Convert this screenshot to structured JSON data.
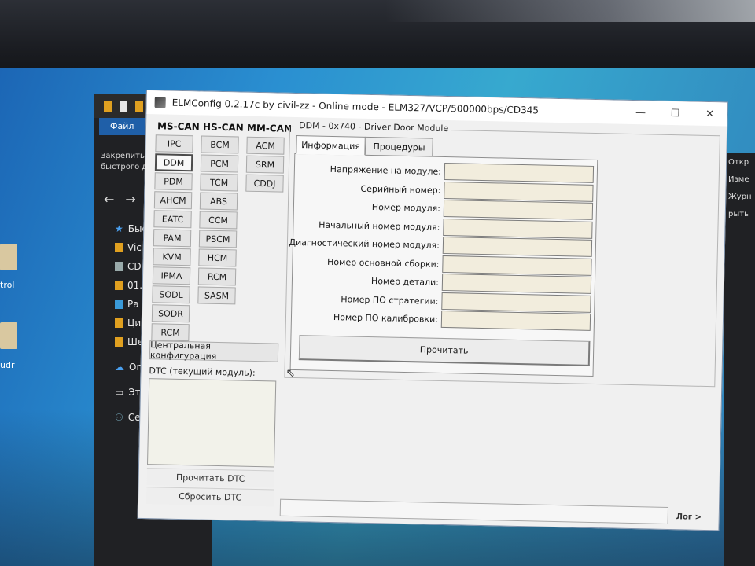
{
  "window": {
    "title": "ELMConfig 0.2.17c by civil-zz - Online mode - ELM327/VCP/500000bps/CD345",
    "minimize": "—",
    "maximize": "☐",
    "close": "✕"
  },
  "explorer": {
    "menu": "Файл",
    "pin_text_1": "Закрепить на",
    "pin_text_2": "быстрого д",
    "nav": [
      "Быс",
      "Vic",
      "CD",
      "01.",
      "Ра",
      "Ци",
      "Ше",
      "One",
      "Этот",
      "Сеть"
    ],
    "right": [
      "Откр",
      "Изме",
      "Журн",
      "рыть"
    ]
  },
  "desktop": {
    "labels": [
      "trol",
      "udr"
    ]
  },
  "modules": {
    "ms_can_header": "MS-CAN",
    "hs_can_header": "HS-CAN",
    "mm_can_header": "MM-CAN",
    "ms_can": [
      "IPC",
      "DDM",
      "PDM",
      "AHCM",
      "EATC",
      "PAM",
      "KVM",
      "IPMA",
      "SODL",
      "SODR",
      "RCM"
    ],
    "hs_can": [
      "BCM",
      "PCM",
      "TCM",
      "ABS",
      "CCM",
      "PSCM",
      "HCM",
      "RCM",
      "SASM"
    ],
    "mm_can": [
      "ACM",
      "SRM",
      "CDDJ"
    ],
    "selected": "DDM"
  },
  "left": {
    "central_config": "Центральная конфигурация",
    "dtc_label": "DTC (текущий модуль):",
    "read_dtc": "Прочитать DTC",
    "clear_dtc": "Сбросить DTC"
  },
  "module_panel": {
    "group_title": "DDM - 0x740 - Driver Door Module",
    "tabs": [
      "Информация",
      "Процедуры"
    ],
    "active_tab": "Информация",
    "fields": [
      "Напряжение на модуле:",
      "Серийный номер:",
      "Номер модуля:",
      "Начальный номер модуля:",
      "Диагностический номер модуля:",
      "Номер основной сборки:",
      "Номер детали:",
      "Номер ПО стратегии:",
      "Номер ПО калибровки:"
    ],
    "read_button": "Прочитать"
  },
  "log": {
    "label": "Лог >"
  },
  "colors": {
    "field_bg": "#f2eddd",
    "window_bg": "#f0f0f0",
    "desktop": "#2a8fd1"
  }
}
